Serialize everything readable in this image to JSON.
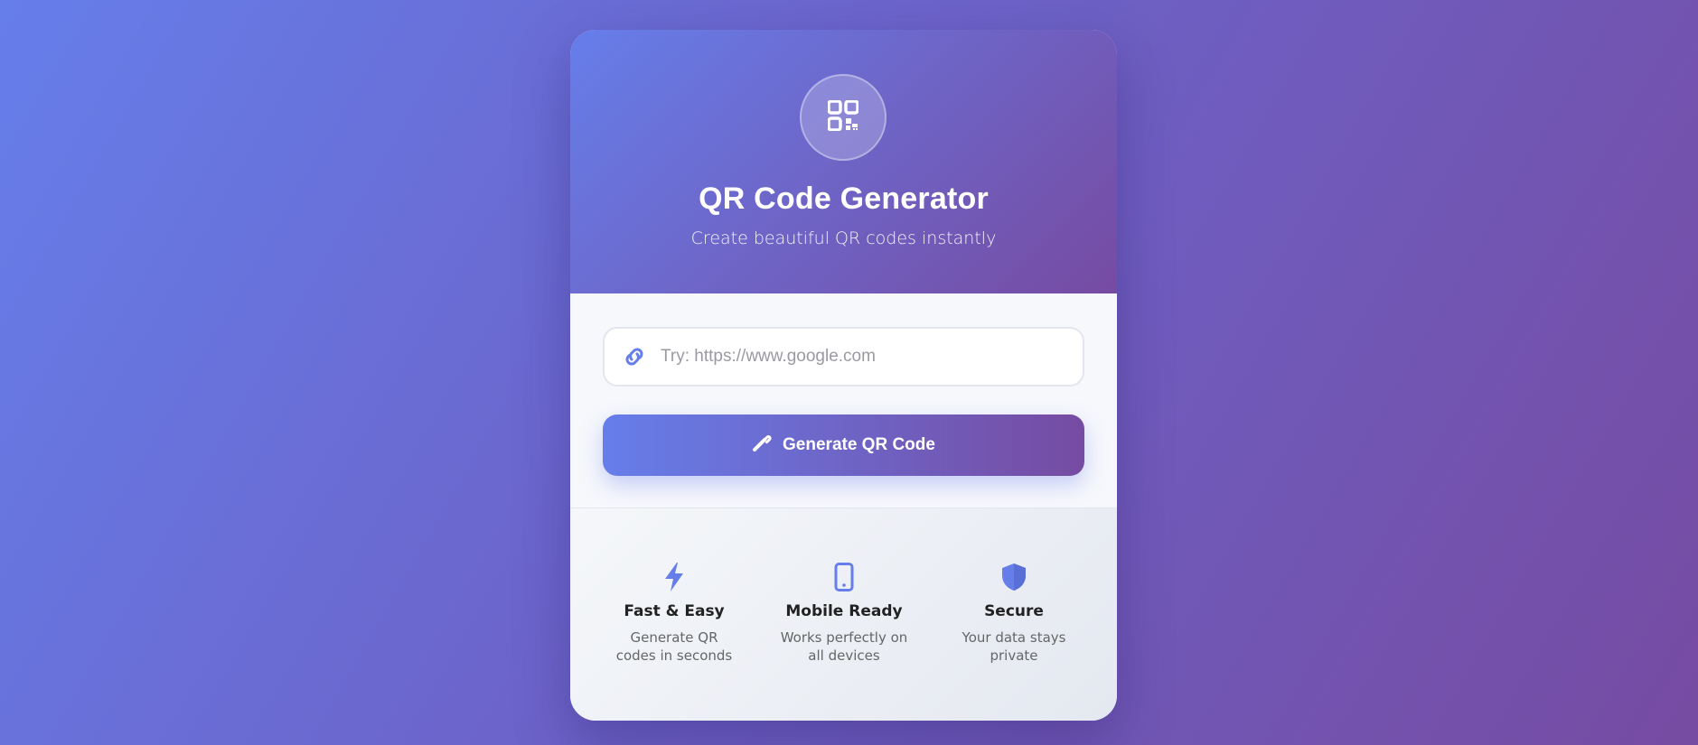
{
  "header": {
    "logo_icon": "qr-code-icon",
    "title": "QR Code Generator",
    "subtitle": "Create beautiful QR codes instantly"
  },
  "form": {
    "input_icon": "link-icon",
    "url_value": "",
    "url_placeholder": "Try: https://www.google.com",
    "button_icon": "magic-wand-icon",
    "button_label": "Generate QR Code"
  },
  "features": [
    {
      "icon": "bolt-icon",
      "title": "Fast & Easy",
      "desc_line1": "Generate QR",
      "desc_line2": "codes in seconds"
    },
    {
      "icon": "mobile-phone-icon",
      "title": "Mobile Ready",
      "desc_line1": "Works perfectly on",
      "desc_line2": "all devices"
    },
    {
      "icon": "shield-icon",
      "title": "Secure",
      "desc_line1": "Your data stays",
      "desc_line2": "private"
    }
  ],
  "colors": {
    "accent_start": "#667eea",
    "accent_end": "#764ba2",
    "feature_icon": "#667eea"
  }
}
